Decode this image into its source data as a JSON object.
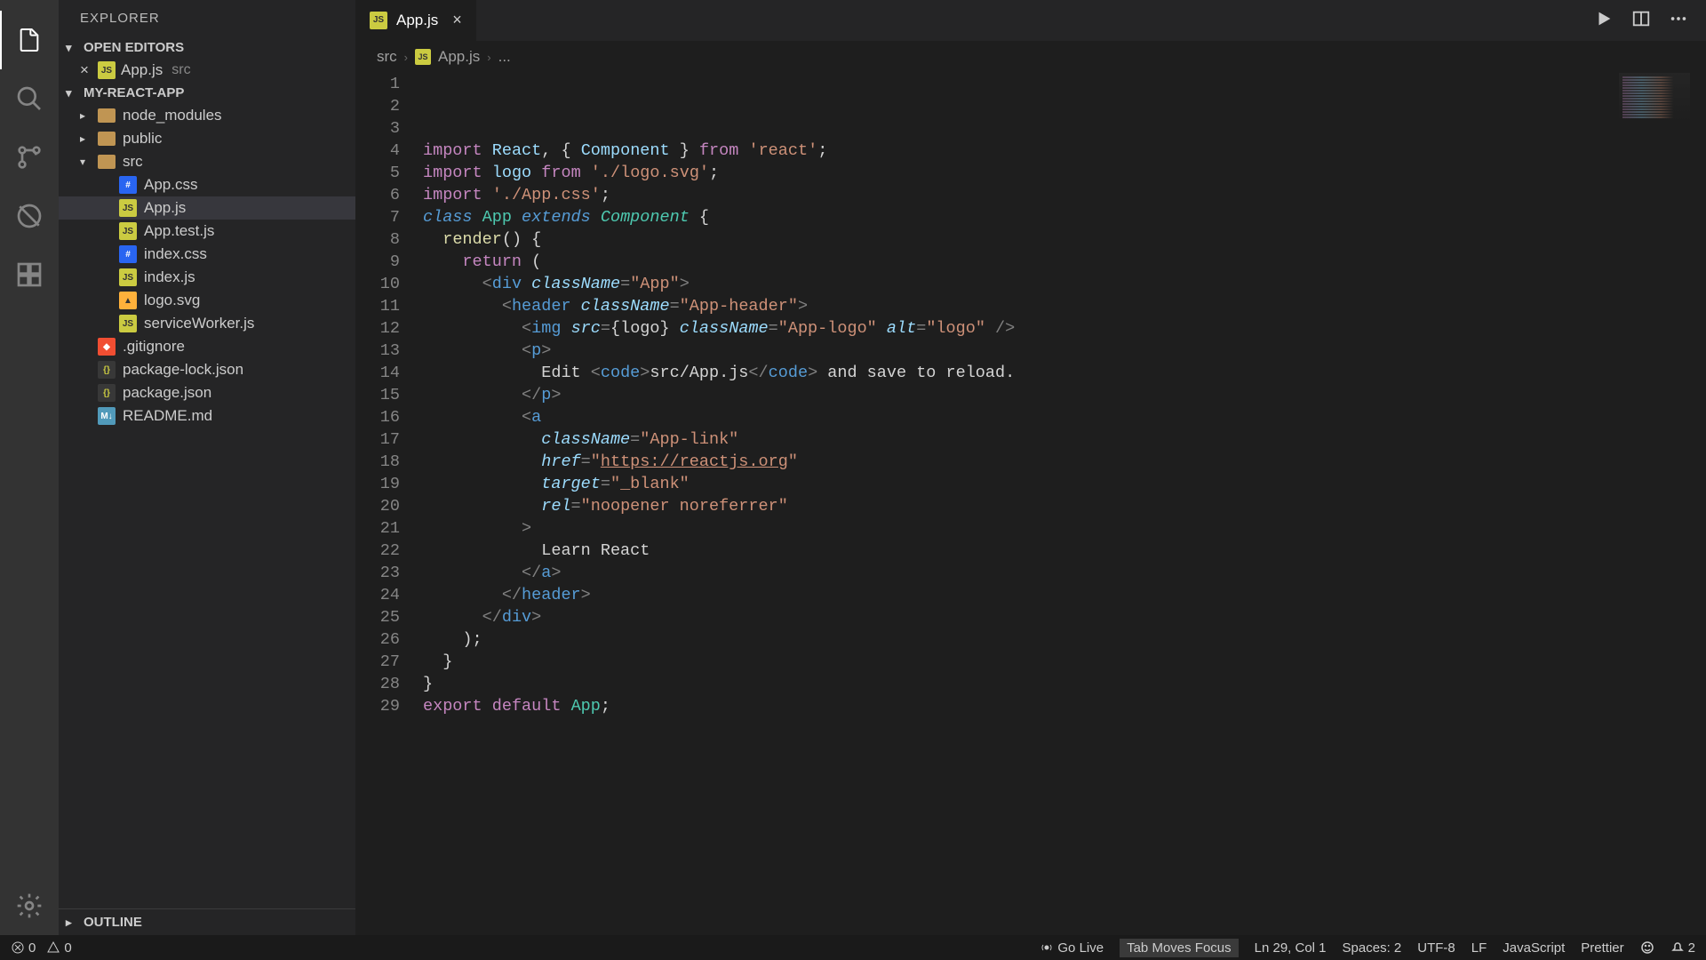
{
  "activityBar": {
    "items": [
      "files",
      "search",
      "git",
      "debug",
      "extensions"
    ],
    "bottom": "settings"
  },
  "sidebar": {
    "title": "EXPLORER",
    "openEditors": {
      "label": "OPEN EDITORS",
      "items": [
        {
          "name": "App.js",
          "dir": "src"
        }
      ]
    },
    "project": {
      "name": "MY-REACT-APP",
      "tree": [
        {
          "type": "folder",
          "name": "node_modules",
          "depth": 0,
          "expanded": false
        },
        {
          "type": "folder",
          "name": "public",
          "depth": 0,
          "expanded": false
        },
        {
          "type": "folder",
          "name": "src",
          "depth": 0,
          "expanded": true
        },
        {
          "type": "file",
          "name": "App.css",
          "depth": 1,
          "icon": "css"
        },
        {
          "type": "file",
          "name": "App.js",
          "depth": 1,
          "icon": "js",
          "selected": true
        },
        {
          "type": "file",
          "name": "App.test.js",
          "depth": 1,
          "icon": "js"
        },
        {
          "type": "file",
          "name": "index.css",
          "depth": 1,
          "icon": "css"
        },
        {
          "type": "file",
          "name": "index.js",
          "depth": 1,
          "icon": "js"
        },
        {
          "type": "file",
          "name": "logo.svg",
          "depth": 1,
          "icon": "svg"
        },
        {
          "type": "file",
          "name": "serviceWorker.js",
          "depth": 1,
          "icon": "js"
        },
        {
          "type": "file",
          "name": ".gitignore",
          "depth": 0,
          "icon": "git"
        },
        {
          "type": "file",
          "name": "package-lock.json",
          "depth": 0,
          "icon": "json"
        },
        {
          "type": "file",
          "name": "package.json",
          "depth": 0,
          "icon": "json"
        },
        {
          "type": "file",
          "name": "README.md",
          "depth": 0,
          "icon": "md"
        }
      ]
    },
    "outline": {
      "label": "OUTLINE"
    }
  },
  "editor": {
    "tab": {
      "name": "App.js"
    },
    "breadcrumb": {
      "parts": [
        "src",
        "App.js",
        "..."
      ]
    },
    "code": {
      "lines": 29,
      "content": {
        "l1": {
          "import": "import",
          "ident1": "React",
          "brace1": "{",
          "ident2": "Component",
          "brace2": "}",
          "from": "from",
          "str": "'react'"
        },
        "l2": {
          "import": "import",
          "ident": "logo",
          "from": "from",
          "str": "'./logo.svg'"
        },
        "l3": {
          "import": "import",
          "str": "'./App.css'"
        },
        "l5": {
          "class": "class",
          "name": "App",
          "extends": "extends",
          "super": "Component",
          "brace": "{"
        },
        "l6": {
          "fn": "render",
          "parens": "()",
          "brace": "{"
        },
        "l7": {
          "return": "return",
          "paren": "("
        },
        "l8": {
          "tag": "div",
          "attr": "className",
          "val": "\"App\""
        },
        "l9": {
          "tag": "header",
          "attr": "className",
          "val": "\"App-header\""
        },
        "l10": {
          "tag": "img",
          "attr1": "src",
          "val1": "{logo}",
          "attr2": "className",
          "val2": "\"App-logo\"",
          "attr3": "alt",
          "val3": "\"logo\""
        },
        "l11": {
          "tag": "p"
        },
        "l12": {
          "text1": "Edit ",
          "tag": "code",
          "text2": "src/App.js",
          "text3": " and save to reload."
        },
        "l13": {
          "tag": "p"
        },
        "l14": {
          "tag": "a"
        },
        "l15": {
          "attr": "className",
          "val": "\"App-link\""
        },
        "l16": {
          "attr": "href",
          "val": "\"https://reactjs.org\"",
          "url": "https://reactjs.org"
        },
        "l17": {
          "attr": "target",
          "val": "\"_blank\""
        },
        "l18": {
          "attr": "rel",
          "val": "\"noopener noreferrer\""
        },
        "l20": {
          "text": "Learn React"
        },
        "l21": {
          "tag": "a"
        },
        "l22": {
          "tag": "header"
        },
        "l23": {
          "tag": "div"
        },
        "l28": {
          "export": "export",
          "default": "default",
          "name": "App"
        }
      }
    }
  },
  "statusBar": {
    "errors": "0",
    "warnings": "0",
    "goLive": "Go Live",
    "tabFocus": "Tab Moves Focus",
    "cursor": "Ln 29, Col 1",
    "spaces": "Spaces: 2",
    "encoding": "UTF-8",
    "eol": "LF",
    "language": "JavaScript",
    "prettier": "Prettier",
    "notifications": "2"
  }
}
